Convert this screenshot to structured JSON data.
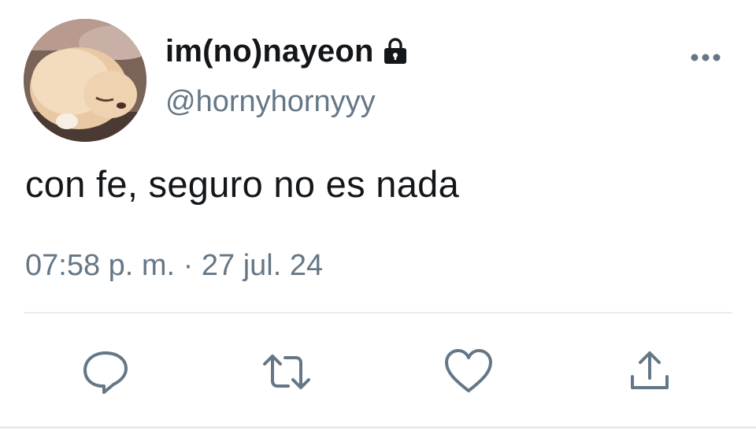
{
  "tweet": {
    "display_name": "im(no)nayeon",
    "handle": "@hornyhornyyy",
    "text": "con fe, seguro no es nada",
    "timestamp": "07:58 p. m. · 27 jul. 24"
  },
  "icons": {
    "protected": "lock-icon",
    "more": "more-options-icon",
    "reply": "reply-icon",
    "retweet": "retweet-icon",
    "like": "heart-icon",
    "share": "share-icon"
  },
  "colors": {
    "text_primary": "#14171a",
    "text_secondary": "#657786",
    "icon": "#657786",
    "divider": "#e6ecf0"
  }
}
